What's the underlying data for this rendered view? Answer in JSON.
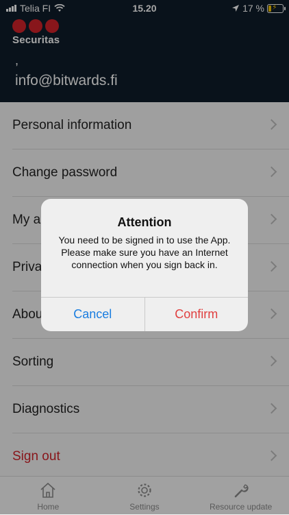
{
  "status_bar": {
    "carrier": "Telia FI",
    "time": "15.20",
    "battery_text": "17 %",
    "battery_level": 0.17
  },
  "header": {
    "logo_text": "Securitas",
    "user_name": ",",
    "user_email": "info@bitwards.fi"
  },
  "menu": {
    "items": [
      {
        "label": "Personal information"
      },
      {
        "label": "Change password"
      },
      {
        "label": "My a"
      },
      {
        "label": "Priva"
      },
      {
        "label": "Abou"
      },
      {
        "label": "Sorting"
      },
      {
        "label": "Diagnostics"
      },
      {
        "label": "Sign out"
      }
    ]
  },
  "tab_bar": {
    "tabs": [
      {
        "label": "Home",
        "icon": "home-icon"
      },
      {
        "label": "Settings",
        "icon": "gear-icon"
      },
      {
        "label": "Resource update",
        "icon": "wrench-icon"
      }
    ]
  },
  "dialog": {
    "title": "Attention",
    "message": "You need to be signed in to use the App. Please make sure you have an Internet connection when you sign back in.",
    "cancel_label": "Cancel",
    "confirm_label": "Confirm"
  },
  "colors": {
    "header_bg": "#0f1d2a",
    "brand_red": "#d2232a",
    "cancel_blue": "#1a7de0",
    "confirm_red": "#e04040"
  }
}
